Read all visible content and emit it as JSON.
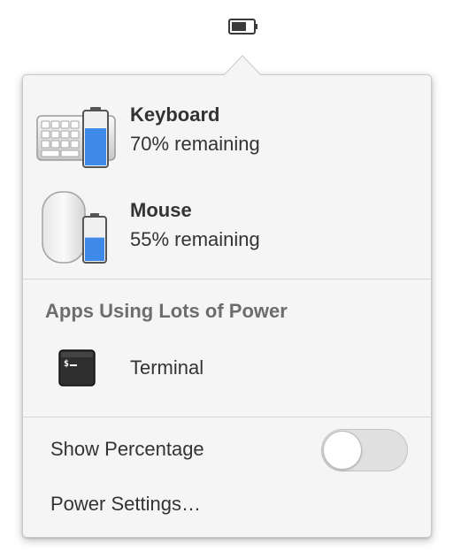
{
  "panel": {
    "indicator_icon": "battery-icon"
  },
  "devices": [
    {
      "name": "Keyboard",
      "status": "70% remaining",
      "level": 0.7,
      "icon": "keyboard-battery-icon"
    },
    {
      "name": "Mouse",
      "status": "55% remaining",
      "level": 0.55,
      "icon": "mouse-battery-icon"
    }
  ],
  "apps_section": {
    "heading": "Apps Using Lots of Power",
    "apps": [
      {
        "name": "Terminal",
        "icon": "terminal-icon"
      }
    ]
  },
  "menu": {
    "show_percentage_label": "Show Percentage",
    "show_percentage_enabled": false,
    "power_settings_label": "Power Settings…"
  },
  "colors": {
    "battery_fill": "#3f8ae8",
    "popover_bg": "#f5f5f5",
    "heading_text": "#6d6d6d"
  }
}
